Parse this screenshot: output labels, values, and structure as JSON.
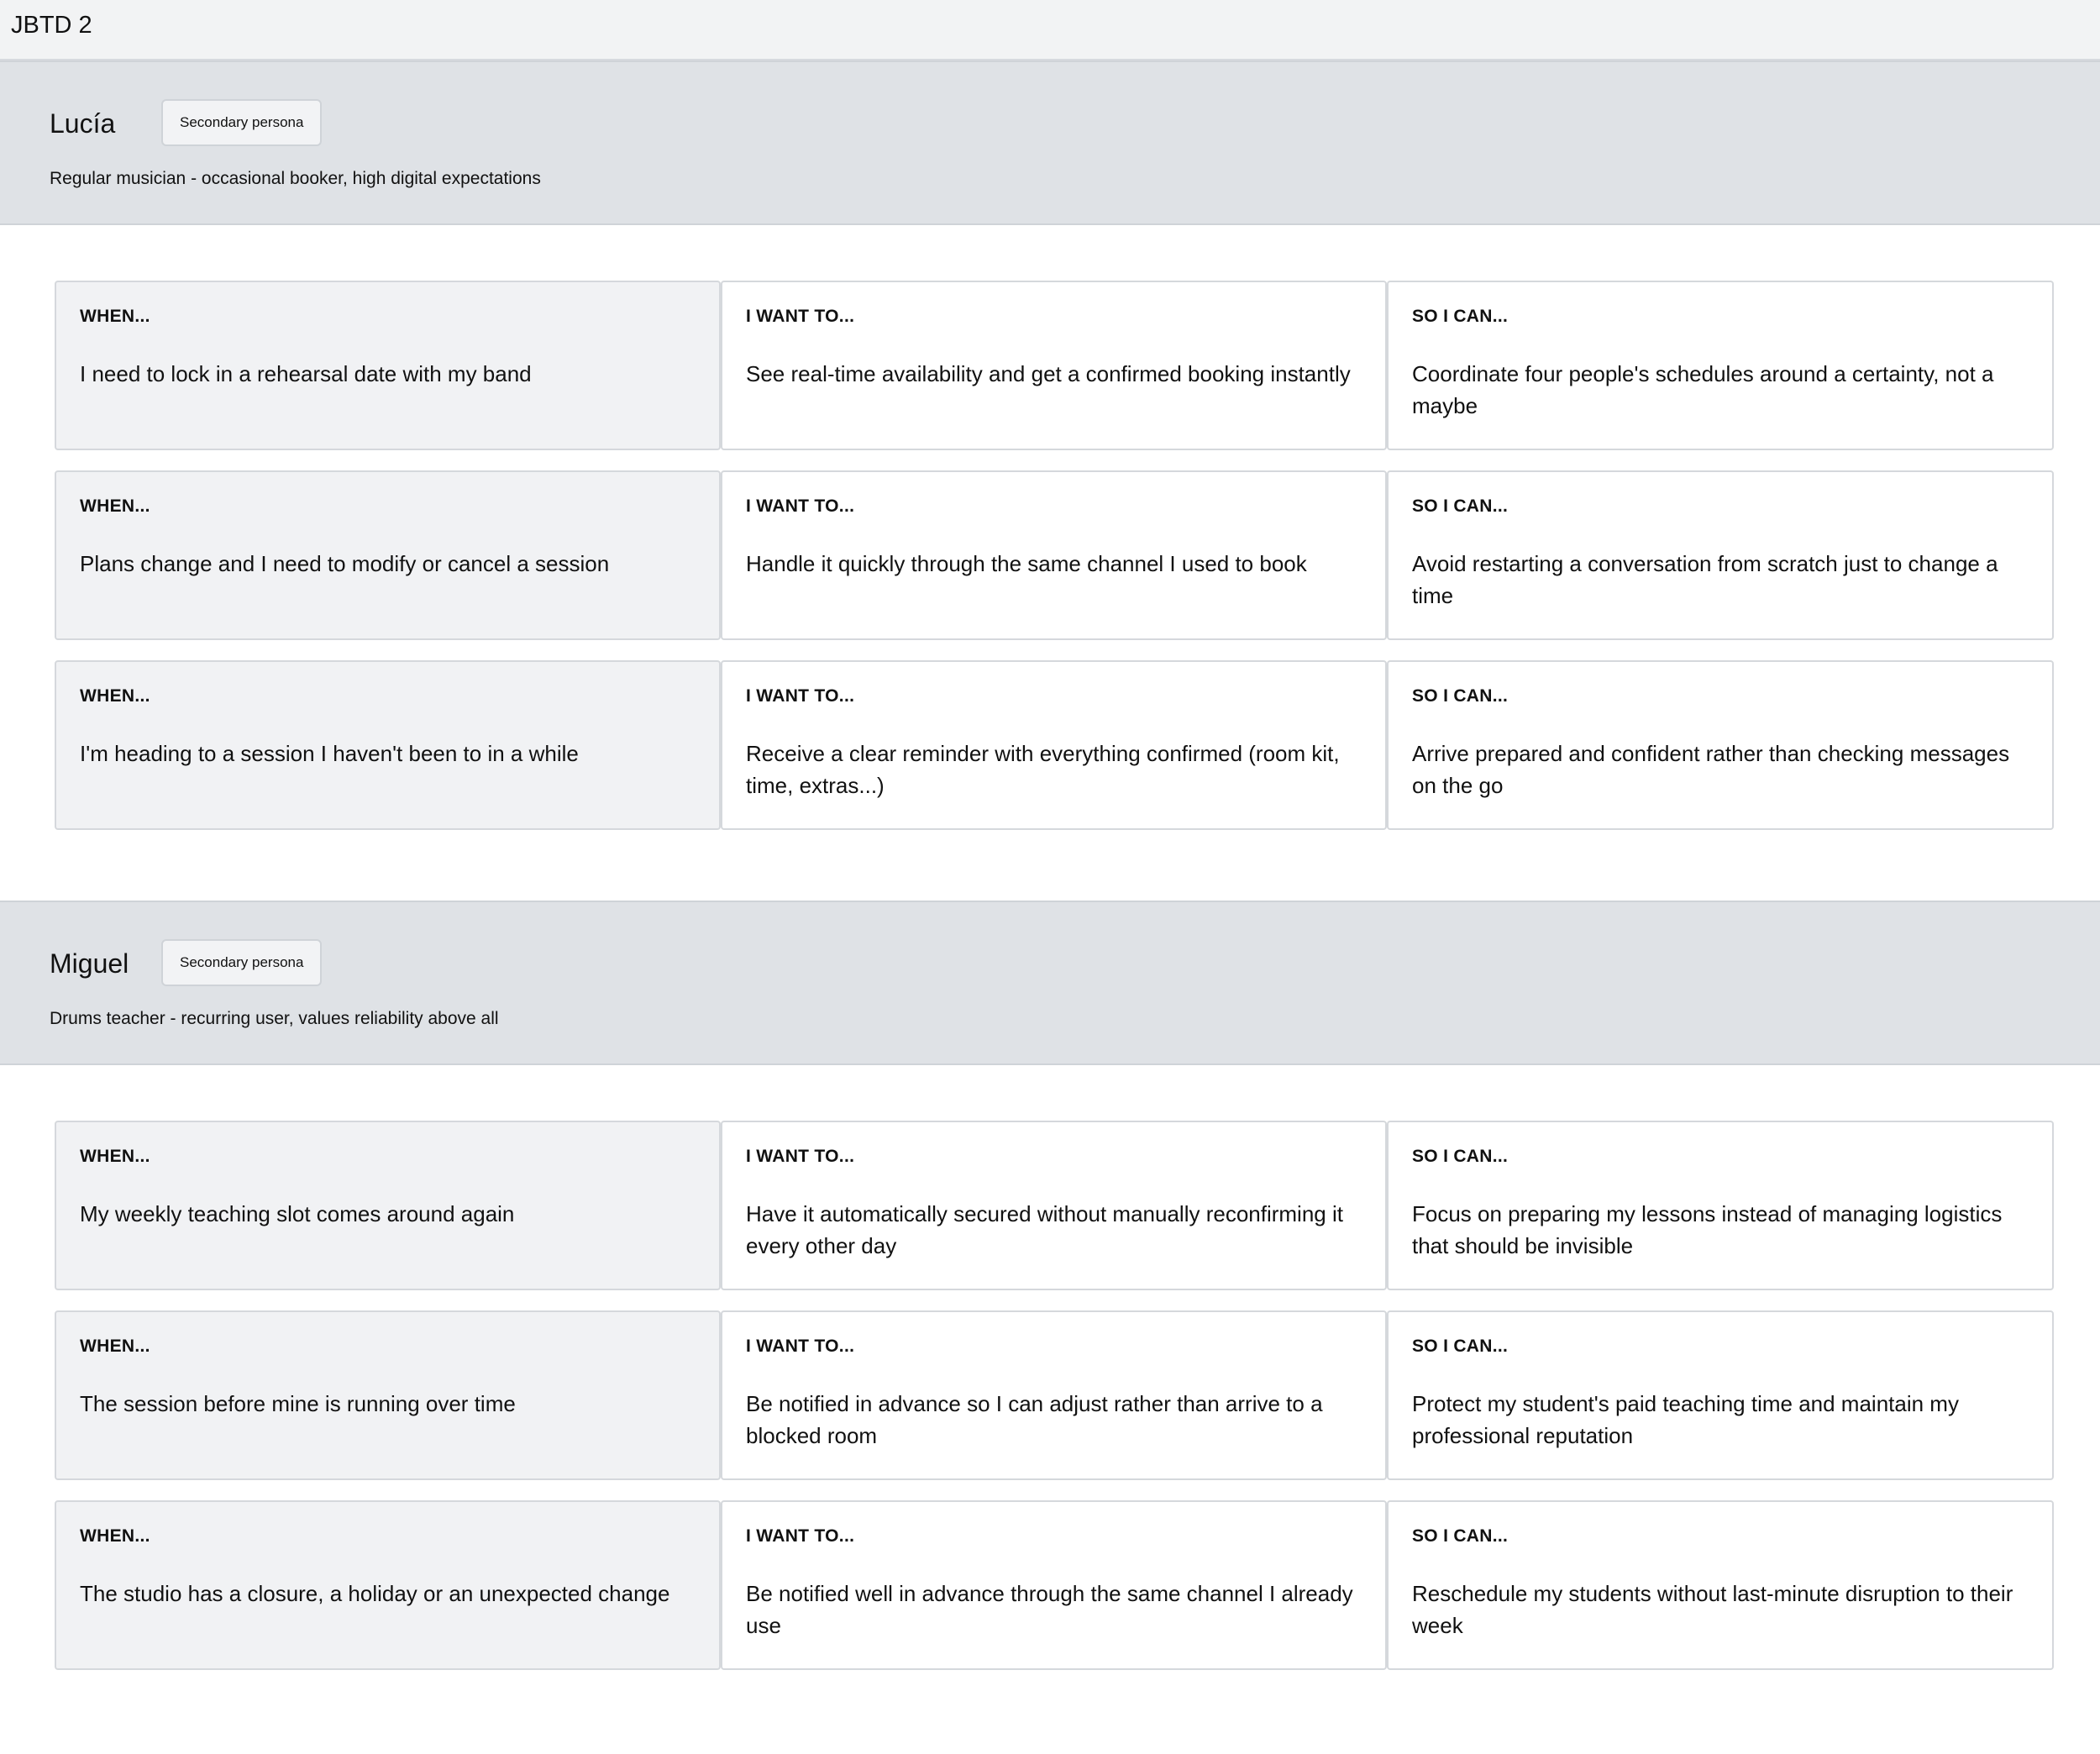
{
  "window": {
    "title": "JBTD 2"
  },
  "labels": {
    "when": "WHEN...",
    "want": "I WANT TO...",
    "so": "SO I CAN..."
  },
  "personas": [
    {
      "name": "Lucía",
      "badge": "Secondary persona",
      "description": "Regular musician - occasional booker, high digital expectations",
      "rows": [
        {
          "when": "I need to lock in a rehearsal date with my band",
          "want": "See real-time availability and get a confirmed booking instantly",
          "so": "Coordinate four people's schedules around a certainty, not a maybe"
        },
        {
          "when": "Plans change and I need  to modify or cancel a session",
          "want": "Handle it quickly through the same channel I used to book",
          "so": "Avoid restarting a conversation from scratch just to change a time"
        },
        {
          "when": "I'm heading to a session I haven't been to in a while",
          "want": "Receive a clear reminder with everything confirmed (room kit, time, extras...)",
          "so": "Arrive prepared and confident rather than checking messages on the go"
        }
      ]
    },
    {
      "name": "Miguel",
      "badge": "Secondary persona",
      "description": "Drums teacher - recurring user, values reliability above all",
      "rows": [
        {
          "when": "My weekly teaching slot comes around again",
          "want": "Have it automatically secured without manually reconfirming it every other day",
          "so": "Focus on preparing my lessons instead of managing logistics that should be invisible"
        },
        {
          "when": "The session before mine is running over time",
          "want": "Be notified in advance so I can adjust rather than arrive to a blocked room",
          "so": "Protect my student's paid teaching time and maintain my professional reputation"
        },
        {
          "when": "The studio has a closure, a holiday or an unexpected change",
          "want": "Be notified well in advance through the same channel I already use",
          "so": "Reschedule my students without last-minute disruption to their week"
        }
      ]
    }
  ]
}
